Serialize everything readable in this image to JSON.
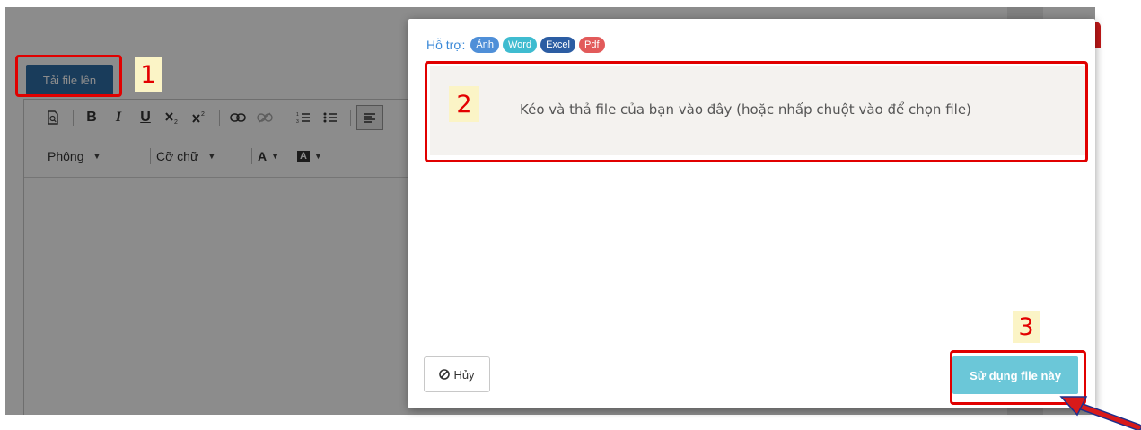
{
  "editor": {
    "upload_button": "Tải file lên",
    "font_select": "Phông",
    "size_select": "Cỡ chữ",
    "toolbar_icons": [
      "preview-icon",
      "bold-icon",
      "italic-icon",
      "underline-icon",
      "subscript-icon",
      "superscript-icon",
      "link-icon",
      "unlink-icon",
      "ordered-list-icon",
      "unordered-list-icon",
      "align-left-icon"
    ],
    "bold_glyph": "B",
    "italic_glyph": "I",
    "underline_glyph": "U",
    "text_color_glyph": "A",
    "bg_color_glyph": "A"
  },
  "modal": {
    "support_label": "Hỗ trợ:",
    "badges": [
      {
        "label": "Ảnh",
        "color": "#4f8fd8"
      },
      {
        "label": "Word",
        "color": "#3fbcd0"
      },
      {
        "label": "Excel",
        "color": "#2c5da3"
      },
      {
        "label": "Pdf",
        "color": "#e25a5a"
      }
    ],
    "dropzone_text": "Kéo và thả file của bạn vào đây (hoặc nhấp chuột vào để chọn file)",
    "cancel_label": "Hủy",
    "use_label": "Sử dụng file này"
  },
  "annotations": {
    "step1": "1",
    "step2": "2",
    "step3": "3",
    "highlight_color": "#e10000",
    "arrow_color": "#d81a1a"
  }
}
